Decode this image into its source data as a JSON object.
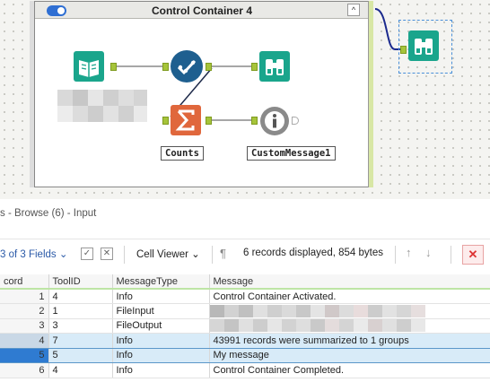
{
  "canvas": {
    "container_title": "Control Container 4",
    "collapse_symbol": "^",
    "tools": [
      {
        "name": "input-data-tool",
        "icon": "book-icon",
        "color": "#1aa58c"
      },
      {
        "name": "check-tool",
        "icon": "checkmark-icon",
        "color": "#1e5f8f"
      },
      {
        "name": "browse-tool-inner",
        "icon": "binoculars-icon",
        "color": "#1aa58c"
      },
      {
        "name": "summarize-tool",
        "icon": "sigma-icon",
        "color": "#e0673c"
      },
      {
        "name": "message-tool",
        "icon": "info-icon",
        "color": "#8a8a8a"
      },
      {
        "name": "browse-tool-outer",
        "icon": "binoculars-icon",
        "color": "#1aa58c"
      }
    ],
    "labels": {
      "counts": "Counts",
      "custom_message": "CustomMessage1"
    }
  },
  "results": {
    "title": "s - Browse (6) - Input",
    "fields": "3 of 3 Fields",
    "viewer": "Cell Viewer",
    "status": "6 records displayed, 854 bytes",
    "columns": [
      "cord",
      "ToolID",
      "MessageType",
      "Message"
    ],
    "rows": [
      {
        "record": "1",
        "toolid": "4",
        "type": "Info",
        "message": "Control Container Activated."
      },
      {
        "record": "2",
        "toolid": "1",
        "type": "FileInput",
        "message": ""
      },
      {
        "record": "3",
        "toolid": "3",
        "type": "FileOutput",
        "message": ""
      },
      {
        "record": "4",
        "toolid": "7",
        "type": "Info",
        "message": "43991 records were summarized to 1 groups"
      },
      {
        "record": "5",
        "toolid": "5",
        "type": "Info",
        "message": "My message"
      },
      {
        "record": "6",
        "toolid": "4",
        "type": "Info",
        "message": "Control Container Completed."
      }
    ]
  },
  "colors": {
    "accent_blue": "#2f6fd3",
    "anchor_green": "#a6c43a",
    "selection": "#d8ebf8"
  }
}
